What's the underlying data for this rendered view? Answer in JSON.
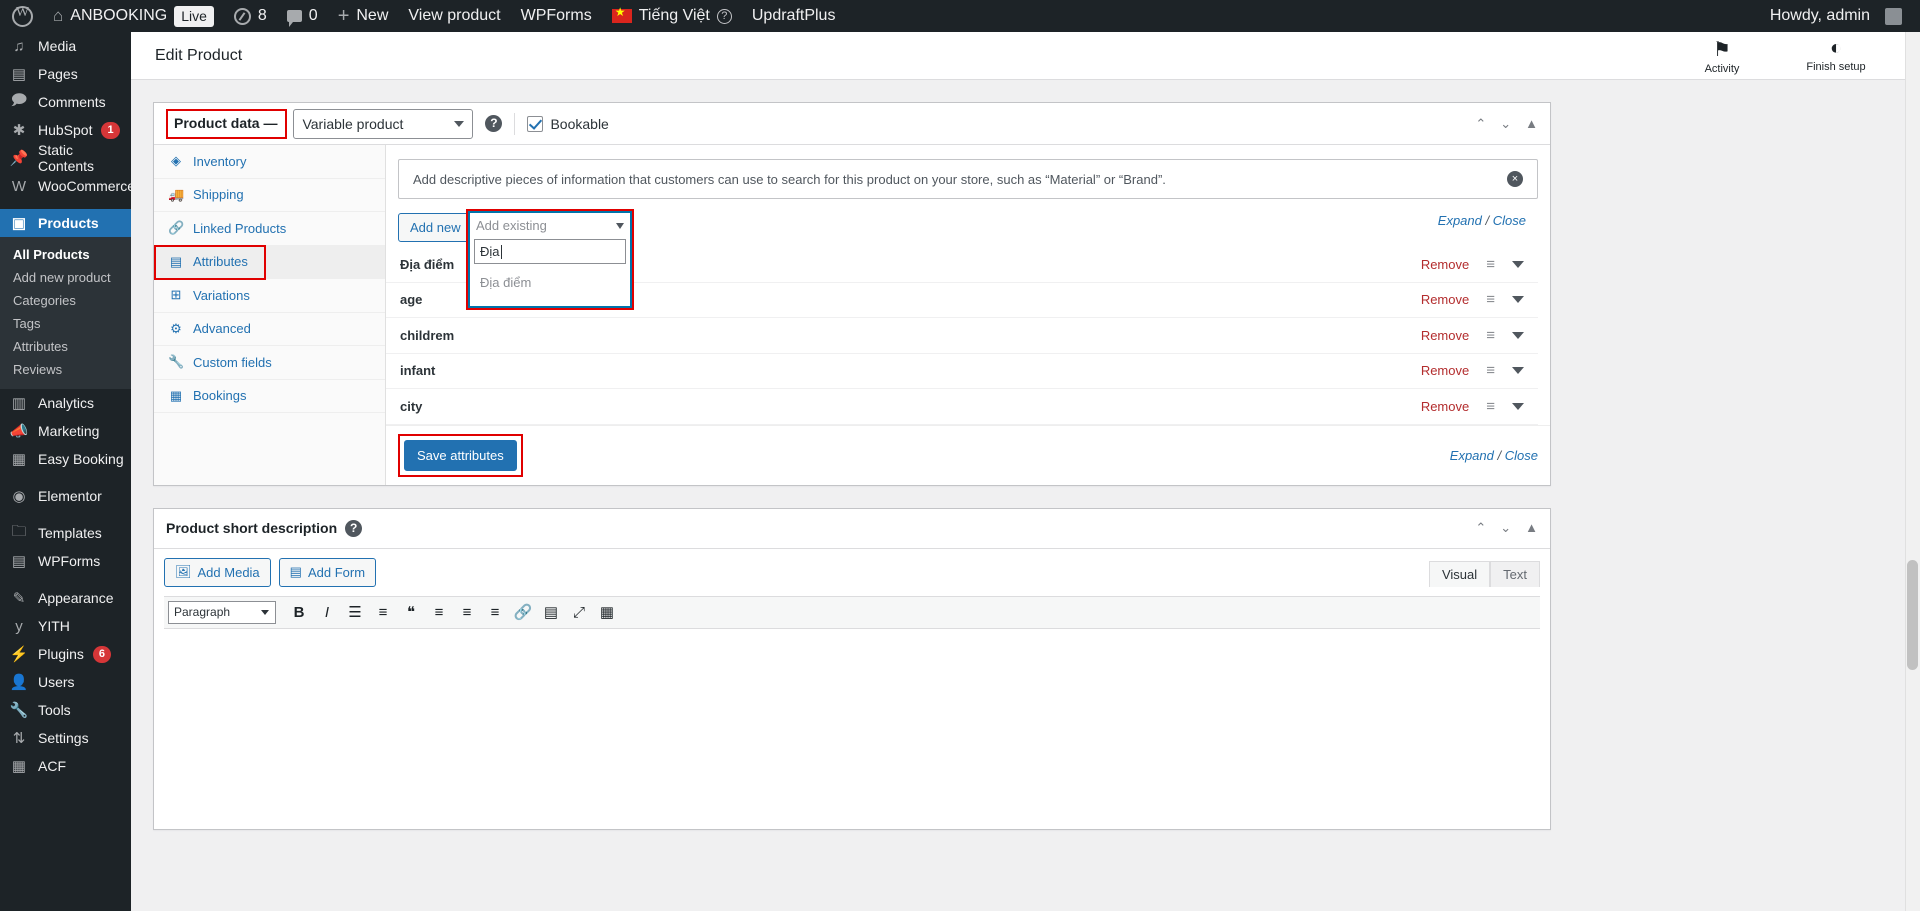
{
  "adminbar": {
    "wp_logo": "wordpress-logo",
    "site_name": "ANBOOKING",
    "live_badge": "Live",
    "updates_count": "8",
    "comments_count": "0",
    "new_label": "New",
    "view_product": "View product",
    "wpforms": "WPForms",
    "language": "Tiếng Việt",
    "updraftplus": "UpdraftPlus",
    "howdy": "Howdy, admin"
  },
  "sidebar": {
    "items": [
      {
        "label": "Media",
        "icon": "media-icon",
        "badge": ""
      },
      {
        "label": "Pages",
        "icon": "pages-icon",
        "badge": ""
      },
      {
        "label": "Comments",
        "icon": "comments-icon",
        "badge": ""
      },
      {
        "label": "HubSpot",
        "icon": "hubspot-icon",
        "badge": "1"
      },
      {
        "label": "Static Contents",
        "icon": "pin-icon",
        "badge": ""
      },
      {
        "label": "WooCommerce",
        "icon": "woocommerce-icon",
        "badge": ""
      },
      {
        "label": "Products",
        "icon": "products-icon",
        "badge": ""
      }
    ],
    "products_submenu": [
      {
        "label": "All Products",
        "current": true
      },
      {
        "label": "Add new product",
        "current": false
      },
      {
        "label": "Categories",
        "current": false
      },
      {
        "label": "Tags",
        "current": false
      },
      {
        "label": "Attributes",
        "current": false
      },
      {
        "label": "Reviews",
        "current": false
      }
    ],
    "items_after": [
      {
        "label": "Analytics",
        "icon": "analytics-icon",
        "badge": ""
      },
      {
        "label": "Marketing",
        "icon": "marketing-icon",
        "badge": ""
      },
      {
        "label": "Easy Booking",
        "icon": "calendar-icon",
        "badge": ""
      },
      {
        "label": "Elementor",
        "icon": "elementor-icon",
        "badge": ""
      },
      {
        "label": "Templates",
        "icon": "folder-icon",
        "badge": ""
      },
      {
        "label": "WPForms",
        "icon": "wpforms-icon",
        "badge": ""
      },
      {
        "label": "Appearance",
        "icon": "brush-icon",
        "badge": ""
      },
      {
        "label": "YITH",
        "icon": "yith-icon",
        "badge": ""
      },
      {
        "label": "Plugins",
        "icon": "plugins-icon",
        "badge": "6"
      },
      {
        "label": "Users",
        "icon": "users-icon",
        "badge": ""
      },
      {
        "label": "Tools",
        "icon": "tools-icon",
        "badge": ""
      },
      {
        "label": "Settings",
        "icon": "settings-icon",
        "badge": ""
      },
      {
        "label": "ACF",
        "icon": "acf-icon",
        "badge": ""
      }
    ]
  },
  "header": {
    "title": "Edit Product",
    "activity": "Activity",
    "finish_setup": "Finish setup"
  },
  "product_data": {
    "panel_title": "Product data —",
    "product_type": "Variable product",
    "product_type_options": [
      "Variable product"
    ],
    "help_tip": "?",
    "bookable_label": "Bookable",
    "bookable_checked": true,
    "tabs": [
      {
        "label": "Inventory",
        "icon": "inventory-icon",
        "active": false
      },
      {
        "label": "Shipping",
        "icon": "truck-icon",
        "active": false
      },
      {
        "label": "Linked Products",
        "icon": "link-icon",
        "active": false
      },
      {
        "label": "Attributes",
        "icon": "attributes-icon",
        "active": true
      },
      {
        "label": "Variations",
        "icon": "grid-icon",
        "active": false
      },
      {
        "label": "Advanced",
        "icon": "gear-icon",
        "active": false
      },
      {
        "label": "Custom fields",
        "icon": "wrench-icon",
        "active": false
      },
      {
        "label": "Bookings",
        "icon": "calendar-icon",
        "active": false
      }
    ],
    "hint_text": "Add descriptive pieces of information that customers can use to search for this product on your store, such as “Material” or “Brand”.",
    "hint_dismiss": "×",
    "add_new_label": "Add new",
    "add_existing_placeholder": "Add existing",
    "search_value": "Địa",
    "dropdown_options": [
      "Địa điểm"
    ],
    "expand_label": "Expand",
    "close_label": "Close",
    "separator": "/",
    "rows": [
      {
        "name": "Địa điểm",
        "remove": "Remove"
      },
      {
        "name": "age",
        "remove": "Remove"
      },
      {
        "name": "childrem",
        "remove": "Remove"
      },
      {
        "name": "infant",
        "remove": "Remove"
      },
      {
        "name": "city",
        "remove": "Remove"
      }
    ],
    "save_attributes": "Save attributes"
  },
  "short_description": {
    "title": "Product short description",
    "help_tip": "?",
    "add_media": "Add Media",
    "add_form": "Add Form",
    "tab_visual": "Visual",
    "tab_text": "Text",
    "format_select": "Paragraph",
    "toolbar_buttons": [
      {
        "name": "bold-icon",
        "glyph": "B"
      },
      {
        "name": "italic-icon",
        "glyph": "I"
      },
      {
        "name": "bulleted-list-icon",
        "glyph": "☰"
      },
      {
        "name": "numbered-list-icon",
        "glyph": "≡"
      },
      {
        "name": "blockquote-icon",
        "glyph": "❝"
      },
      {
        "name": "align-left-icon",
        "glyph": "≡"
      },
      {
        "name": "align-center-icon",
        "glyph": "≡"
      },
      {
        "name": "align-right-icon",
        "glyph": "≡"
      },
      {
        "name": "link-icon",
        "glyph": "🔗"
      },
      {
        "name": "read-more-icon",
        "glyph": "▤"
      },
      {
        "name": "fullscreen-icon",
        "glyph": "⤢"
      },
      {
        "name": "toolbar-toggle-icon",
        "glyph": "▦"
      }
    ]
  },
  "colors": {
    "accent": "#2271b1",
    "highlight": "#e00000",
    "danger": "#b32d2e",
    "sidebar_bg": "#1d2327"
  }
}
